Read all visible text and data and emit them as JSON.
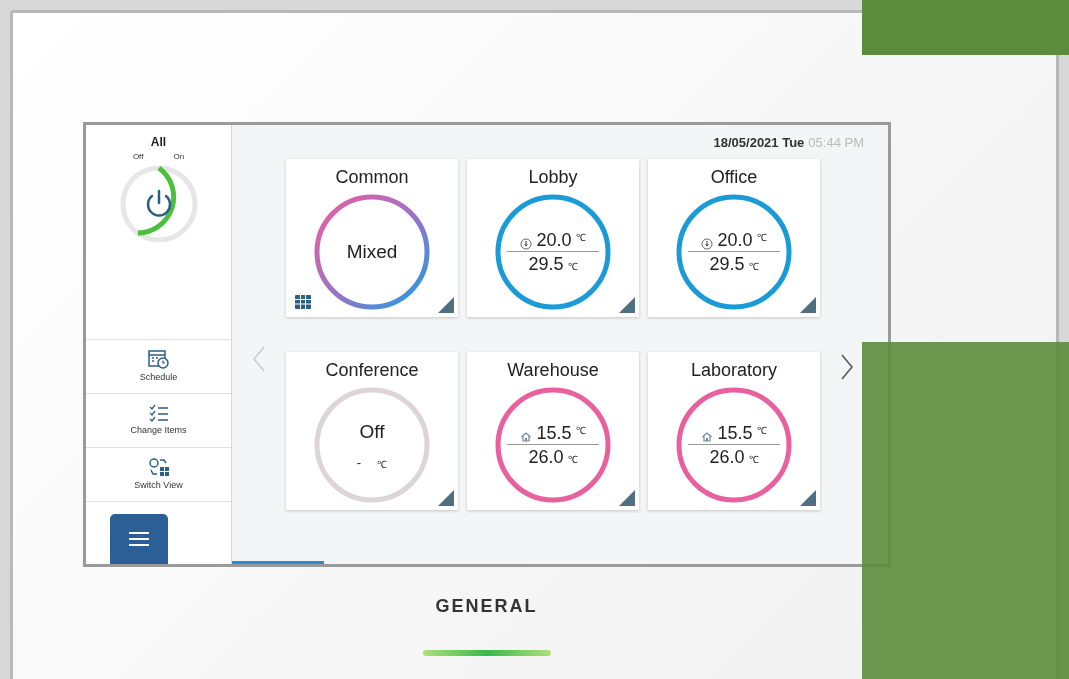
{
  "sidebar": {
    "all_label": "All",
    "off_label": "Off",
    "on_label": "On",
    "power_on": true,
    "menu": [
      {
        "kind": "schedule",
        "label": "Schedule"
      },
      {
        "kind": "change",
        "label": "Change Items"
      },
      {
        "kind": "switch",
        "label": "Switch View"
      }
    ]
  },
  "header": {
    "date": "18/05/2021 Tue",
    "time": "05:44 PM"
  },
  "cards": [
    {
      "name": "Common",
      "kind": "mixed",
      "group": true,
      "status": "Mixed"
    },
    {
      "name": "Lobby",
      "kind": "cool",
      "group": false,
      "set": "20.0",
      "set_unit": "℃",
      "room": "29.5",
      "room_unit": "℃"
    },
    {
      "name": "Office",
      "kind": "cool",
      "group": false,
      "set": "20.0",
      "set_unit": "℃",
      "room": "29.5",
      "room_unit": "℃"
    },
    {
      "name": "Conference",
      "kind": "off",
      "group": false,
      "status": "Off",
      "room": "-",
      "room_unit": "℃"
    },
    {
      "name": "Warehouse",
      "kind": "heat",
      "group": false,
      "set": "15.5",
      "set_unit": "℃",
      "room": "26.0",
      "room_unit": "℃"
    },
    {
      "name": "Laboratory",
      "kind": "heat",
      "group": false,
      "set": "15.5",
      "set_unit": "℃",
      "room": "26.0",
      "room_unit": "℃"
    }
  ],
  "brand": "GENERAL"
}
